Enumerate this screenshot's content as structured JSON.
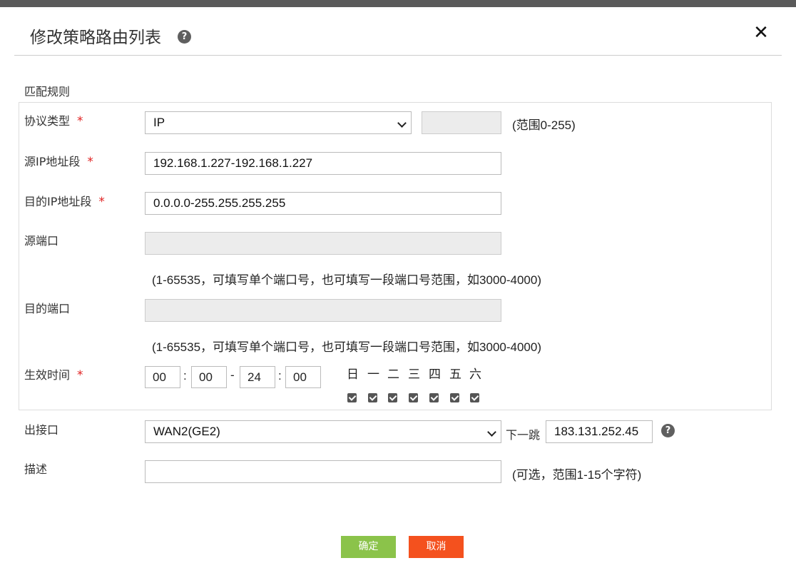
{
  "dialog": {
    "title": "修改策略路由列表",
    "help_glyph": "?",
    "close_glyph": "✕"
  },
  "match_rules": {
    "section_label": "匹配规则",
    "protocol": {
      "label": "协议类型",
      "required": "*",
      "value": "IP",
      "extra_value": "",
      "hint": "(范围0-255)"
    },
    "src_ip": {
      "label": "源IP地址段",
      "required": "*",
      "value": "192.168.1.227-192.168.1.227"
    },
    "dst_ip": {
      "label": "目的IP地址段",
      "required": "*",
      "value": "0.0.0.0-255.255.255.255"
    },
    "src_port": {
      "label": "源端口",
      "value": "",
      "hint": "(1-65535，可填写单个端口号，也可填写一段端口号范围，如3000-4000)"
    },
    "dst_port": {
      "label": "目的端口",
      "value": "",
      "hint": "(1-65535，可填写单个端口号，也可填写一段端口号范围，如3000-4000)"
    },
    "effective_time": {
      "label": "生效时间",
      "required": "*",
      "start_hour": "00",
      "start_min": "00",
      "end_hour": "24",
      "end_min": "00",
      "colon": ":",
      "dash": "-",
      "days": [
        {
          "label": "日",
          "checked": true
        },
        {
          "label": "一",
          "checked": true
        },
        {
          "label": "二",
          "checked": true
        },
        {
          "label": "三",
          "checked": true
        },
        {
          "label": "四",
          "checked": true
        },
        {
          "label": "五",
          "checked": true
        },
        {
          "label": "六",
          "checked": true
        }
      ]
    }
  },
  "egress": {
    "label": "出接口",
    "value": "WAN2(GE2)",
    "next_hop_label": "下一跳",
    "next_hop_value": "183.131.252.45"
  },
  "description": {
    "label": "描述",
    "value": "",
    "hint": "(可选，范围1-15个字符)"
  },
  "buttons": {
    "ok": "确定",
    "cancel": "取消"
  },
  "colors": {
    "ok": "#8bc34a",
    "cancel": "#f4511e",
    "required": "#e02020"
  }
}
